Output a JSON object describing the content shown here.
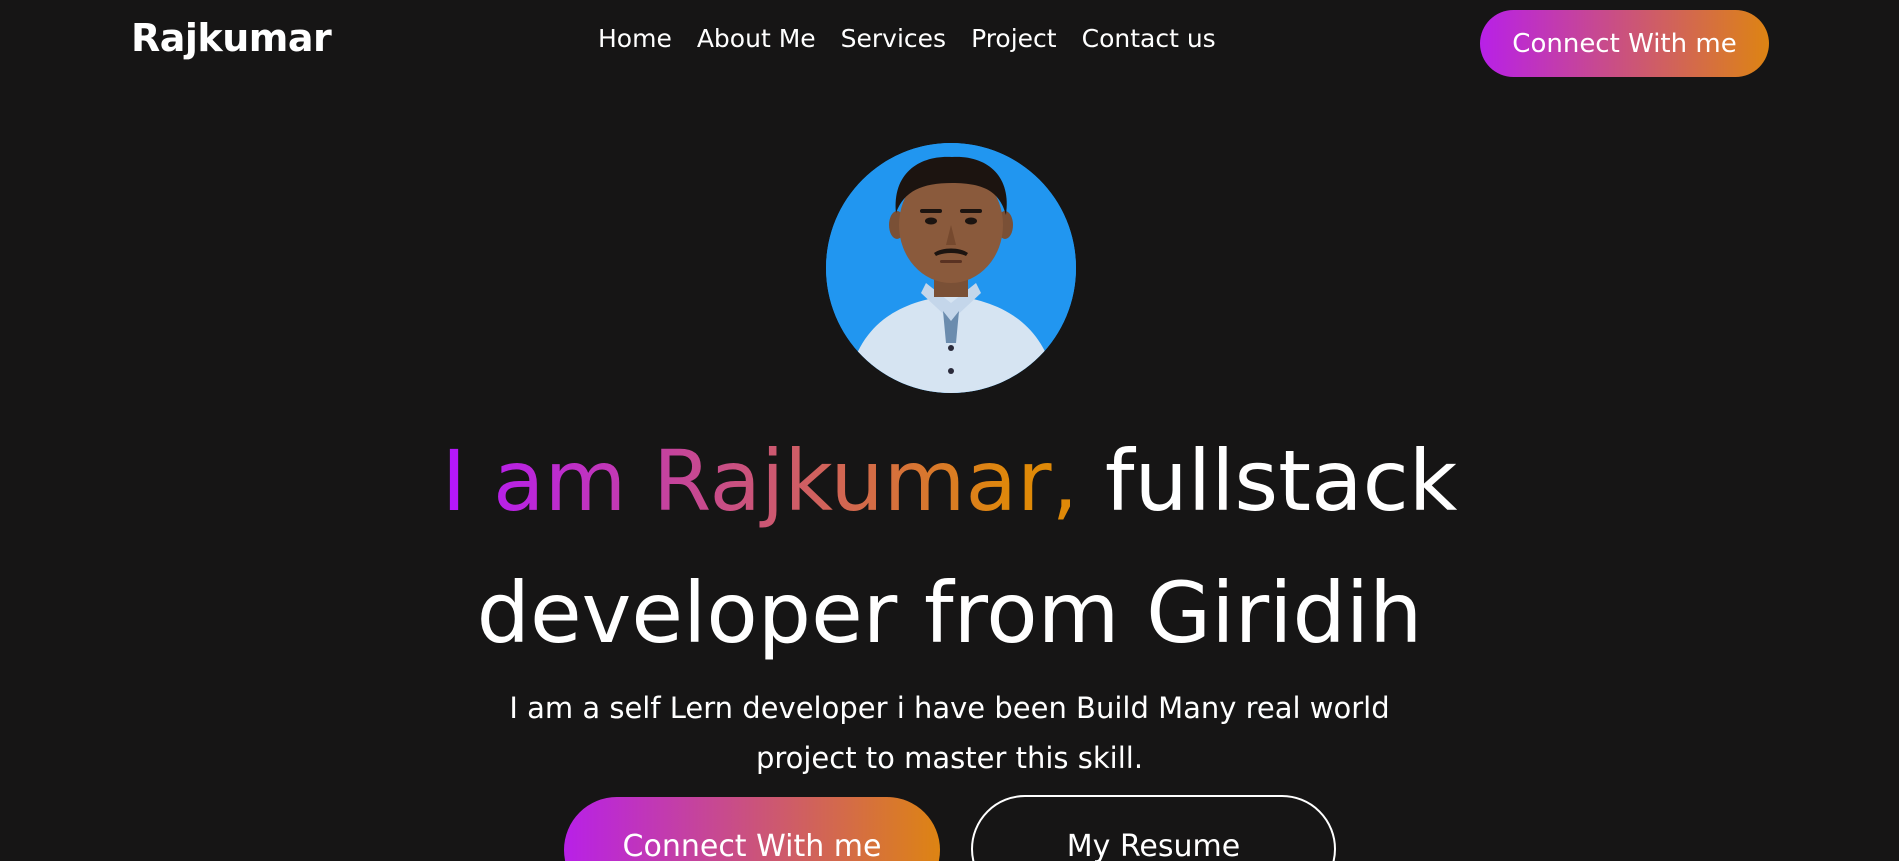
{
  "brand": {
    "logo_text": "Rajkumar"
  },
  "nav": {
    "items": [
      {
        "label": "Home"
      },
      {
        "label": "About Me"
      },
      {
        "label": "Services"
      },
      {
        "label": "Project"
      },
      {
        "label": "Contact us"
      }
    ],
    "connect_button": "Connect With me"
  },
  "hero": {
    "avatar_icon": "profile-photo",
    "title_highlight": "I am Rajkumar,",
    "title_rest_line1": " fullstack",
    "title_line2": "developer from Giridih",
    "description_line1": "I am a self Lern developer i have been Build Many real world",
    "description_line2": "project to master this skill.",
    "connect_button": "Connect With me",
    "resume_button": "My Resume"
  },
  "colors": {
    "background": "#161515",
    "gradient_start": "#b415ff",
    "gradient_end": "#df8908",
    "avatar_background": "#2196f0"
  }
}
